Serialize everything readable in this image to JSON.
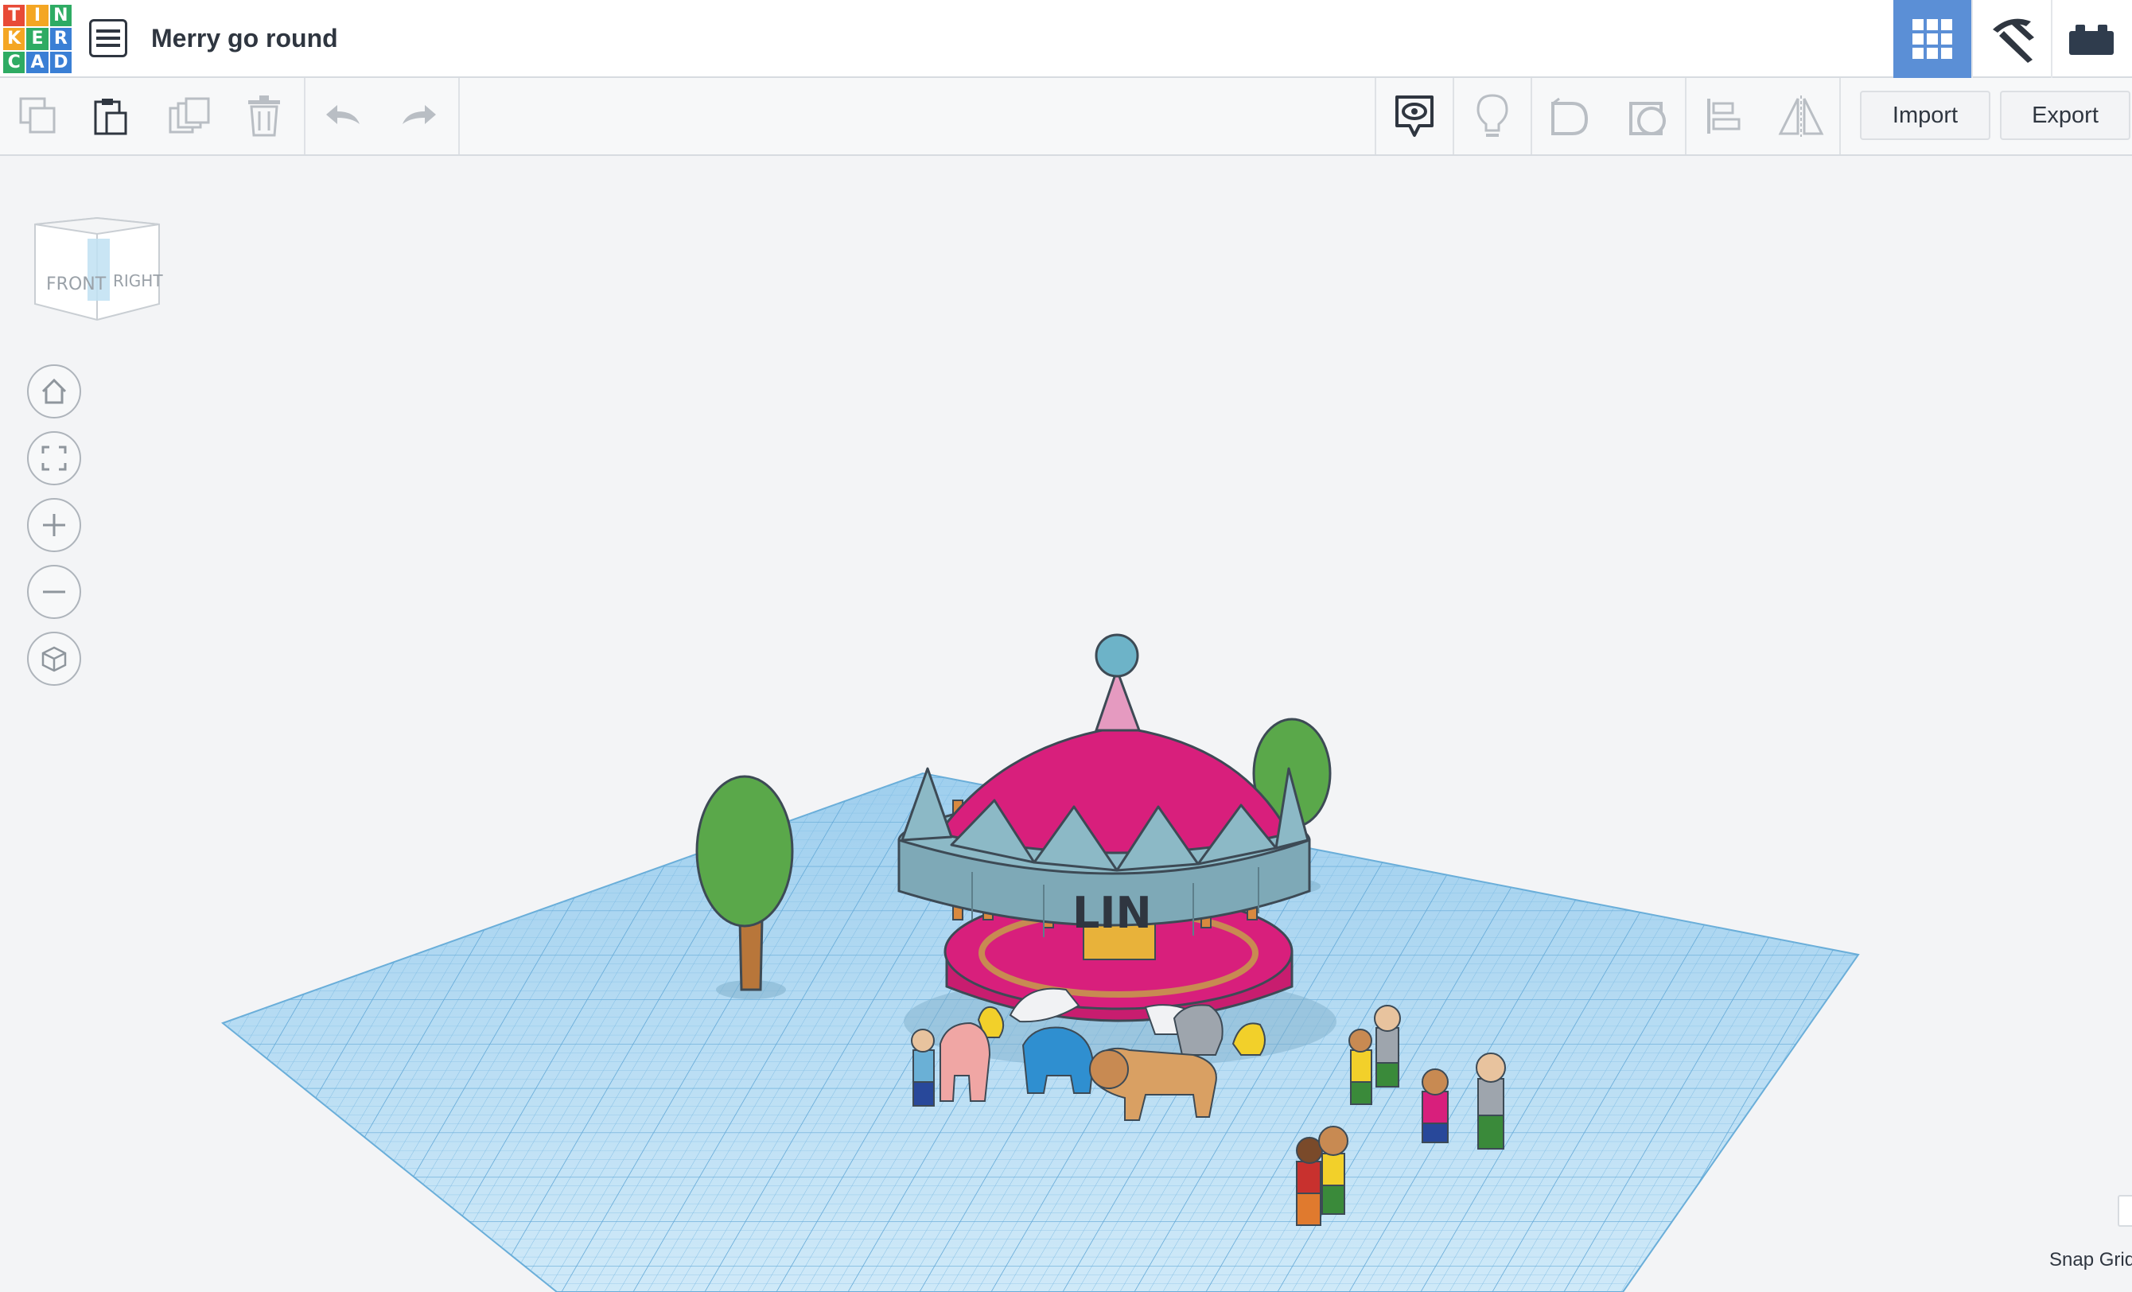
{
  "app": {
    "logo_letters": [
      "T",
      "I",
      "N",
      "K",
      "E",
      "R",
      "C",
      "A",
      "D"
    ],
    "logo_colors": [
      "#e84a37",
      "#f4a623",
      "#2eab63",
      "#f4a623",
      "#2eab63",
      "#3a7fd5",
      "#2eab63",
      "#3a7fd5",
      "#3a7fd5"
    ]
  },
  "header": {
    "title": "Merry go round",
    "modes": [
      {
        "name": "3D Design",
        "icon": "grid-icon",
        "active": true
      },
      {
        "name": "Minecraft",
        "icon": "pickaxe-icon",
        "active": false
      },
      {
        "name": "Lego Bricks",
        "icon": "brick-icon",
        "active": false
      }
    ]
  },
  "toolbar": {
    "left_tools": [
      "copy-icon",
      "paste-icon",
      "duplicate-icon",
      "delete-icon",
      "undo-icon",
      "redo-icon"
    ],
    "right_tools": [
      "notes-icon",
      "light-bulb-icon",
      "solid-shape-icon",
      "hole-shape-icon",
      "align-icon",
      "mirror-icon"
    ],
    "import_label": "Import",
    "export_label": "Export"
  },
  "viewcube": {
    "front_label": "FRONT",
    "right_label": "RIGHT"
  },
  "view_controls": [
    "home-view-icon",
    "fit-all-icon",
    "zoom-in-icon",
    "zoom-out-icon",
    "ortho-view-icon"
  ],
  "workplane": {
    "label": "Workplane",
    "snap_grid_label": "Snap Grid",
    "model_sign_text": "LIN"
  },
  "colors": {
    "accent": "#5b8fd6",
    "grid_blue": "#a9d4ee",
    "canopy_pink": "#d81f7c",
    "canopy_teal": "#8cb9c6"
  }
}
